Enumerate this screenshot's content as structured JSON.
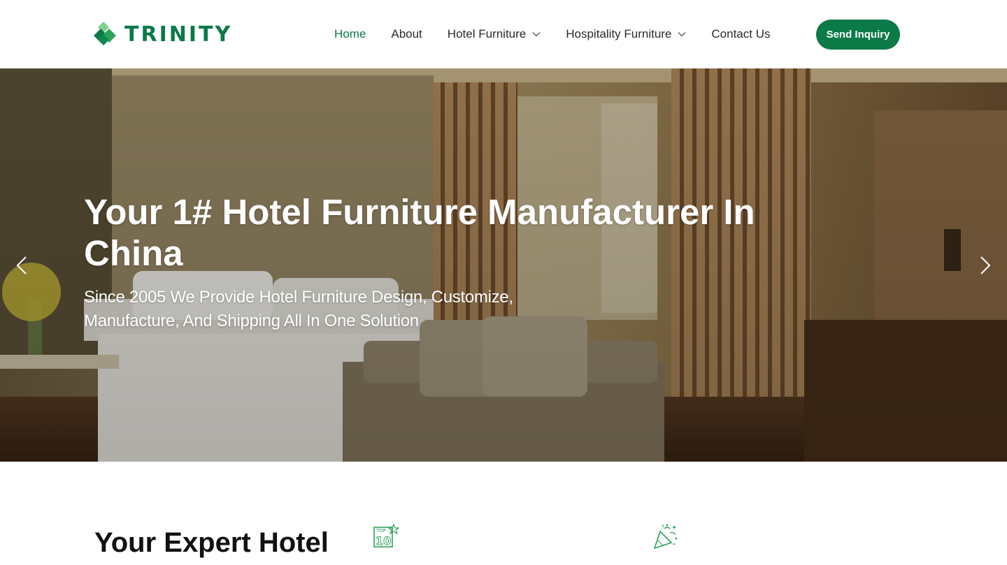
{
  "brand": {
    "name": "TRINITY",
    "color": "#0b7a47"
  },
  "nav": {
    "items": [
      {
        "label": "Home",
        "active": true,
        "dropdown": false
      },
      {
        "label": "About",
        "active": false,
        "dropdown": false
      },
      {
        "label": "Hotel Furniture",
        "active": false,
        "dropdown": true
      },
      {
        "label": "Hospitality Furniture",
        "active": false,
        "dropdown": true
      },
      {
        "label": "Contact Us",
        "active": false,
        "dropdown": false
      }
    ],
    "cta_label": "Send Inquiry"
  },
  "hero": {
    "title": "Your 1# Hotel Furniture Manufacturer In China",
    "subtitle": "Since 2005 We Provide Hotel Furniture Design, Customize, Manufacture, And Shipping All In One Solution",
    "prev_icon": "chevron-left-icon",
    "next_icon": "chevron-right-icon"
  },
  "section": {
    "title": "Your Expert Hotel",
    "icons": [
      {
        "name": "top-10-badge-icon",
        "badge_small": "TOP",
        "badge_big": "10"
      },
      {
        "name": "party-popper-icon"
      }
    ]
  }
}
